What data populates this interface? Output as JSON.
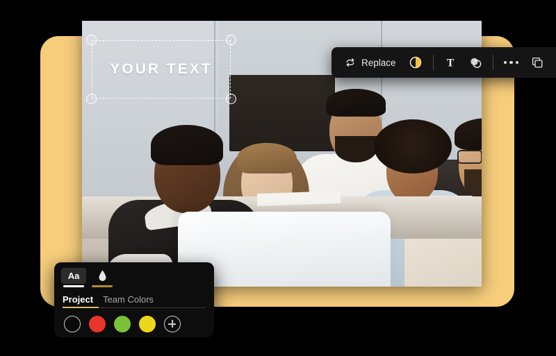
{
  "canvas": {
    "background_color": "#000000",
    "card_color": "#f7cd7c"
  },
  "photo": {
    "alt": "team of five colleagues around a table with a laptop",
    "label": "team-photo"
  },
  "text_element": {
    "value": "YOUR TEXT",
    "selected": "true",
    "handles": [
      "top-left",
      "top-right",
      "bottom-left",
      "bottom-right"
    ]
  },
  "toolbar": {
    "replace_label": "Replace",
    "icons": {
      "replace": "swap-arrows-icon",
      "adjust": "brightness-contrast-icon",
      "text": "text-tool-icon",
      "blend": "opacity-blend-icon",
      "more": "more-options-icon",
      "duplicate": "duplicate-icon",
      "delete": "trash-icon"
    },
    "accent_color": "#f2c230"
  },
  "color_panel": {
    "mode_tabs": [
      {
        "label": "Aa",
        "name": "text-style-tab",
        "active": "false"
      },
      {
        "label": "droplet",
        "name": "fill-color-tab",
        "active": "true"
      }
    ],
    "tabs": [
      {
        "label": "Project",
        "active": "true"
      },
      {
        "label": "Team Colors",
        "active": "false"
      }
    ],
    "swatches": [
      {
        "name": "swatch-black",
        "color": "#0a0a0a",
        "selected": "true"
      },
      {
        "name": "swatch-red",
        "color": "#e8342b",
        "selected": "false"
      },
      {
        "name": "swatch-green",
        "color": "#7cc13a",
        "selected": "false"
      },
      {
        "name": "swatch-yellow",
        "color": "#ecd81a",
        "selected": "false"
      },
      {
        "name": "add-color",
        "color": "",
        "selected": "false"
      }
    ],
    "active_underline_color": "#d9c168"
  }
}
